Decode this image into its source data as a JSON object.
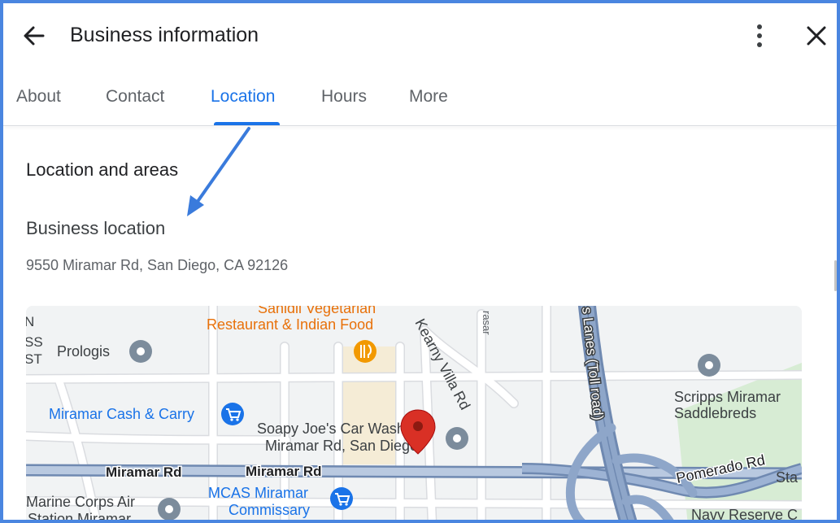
{
  "header": {
    "title": "Business information",
    "back_icon": "arrow-back-icon",
    "more_icon": "more-vert-icon",
    "close_icon": "close-icon"
  },
  "tabs": [
    {
      "label": "About",
      "active": false
    },
    {
      "label": "Contact",
      "active": false
    },
    {
      "label": "Location",
      "active": true
    },
    {
      "label": "Hours",
      "active": false
    },
    {
      "label": "More",
      "active": false
    }
  ],
  "section": {
    "heading": "Location and areas",
    "business_location_label": "Business location",
    "address": "9550 Miramar Rd, San Diego, CA 92126"
  },
  "map": {
    "labels": {
      "restaurant_line1": "Sanidil Vegetarian",
      "restaurant_line2": "Restaurant & Indian Food",
      "edge_n": "N",
      "edge_ss": "SS",
      "edge_st": "ST",
      "prologis": "Prologis",
      "kearny_villa_rd": "Kearny Villa Rd",
      "street_fragment": "rasar",
      "toll_road": "s Lanes (Toll road)",
      "scripps_line1": "Scripps Miramar",
      "scripps_line2": "Saddlebreds",
      "miramar_cash_carry": "Miramar Cash & Carry",
      "soapy_joes_line1": "Soapy Joe's Car Wash -",
      "soapy_joes_line2": "Miramar Rd, San Diego",
      "miramar_rd_left": "Miramar Rd",
      "miramar_rd_center": "Miramar Rd",
      "pomerado_rd": "Pomerado Rd",
      "sta_fragment": "Sta",
      "mcas_line1": "MCAS Miramar",
      "mcas_line2": "Commissary",
      "marine_line1": "Marine Corps Air",
      "marine_line2": "Station Miramar",
      "navy_reserve": "Navy Reserve C"
    },
    "colors": {
      "background": "#f1f3f4",
      "street": "#ffffff",
      "street_outline": "#dadce0",
      "highway": "#8ea6c9",
      "highway_outline": "#6f89b1",
      "park": "#d7ecd4",
      "land_tan": "#f5ecd6",
      "poi_text": "#3c4043",
      "shop_text": "#1a73e8",
      "food_text": "#e8710a",
      "pin": "#d93025"
    },
    "icons": {
      "poi": "place-icon",
      "shopping": "shopping-cart-icon",
      "restaurant": "restaurant-icon",
      "marker": "location-pin-icon"
    }
  },
  "annotation": {
    "arrow_color": "#3a7bdc"
  }
}
